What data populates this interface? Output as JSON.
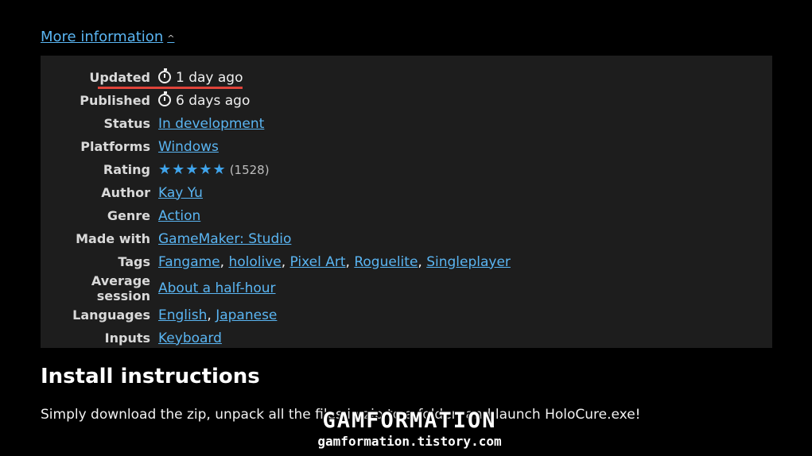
{
  "more_information": {
    "label": "More information"
  },
  "rows": [
    {
      "key": "Updated",
      "value": "1 day ago"
    },
    {
      "key": "Published",
      "value": "6 days ago"
    },
    {
      "key": "Status",
      "value": "In development"
    },
    {
      "key": "Platforms",
      "value": "Windows"
    },
    {
      "key": "Rating",
      "stars": "★★★★★",
      "count": "(1528)"
    },
    {
      "key": "Author",
      "value": "Kay Yu"
    },
    {
      "key": "Genre",
      "value": "Action"
    },
    {
      "key": "Made with",
      "value": "GameMaker: Studio"
    },
    {
      "key": "Tags",
      "values": [
        "Fangame",
        "hololive",
        "Pixel Art",
        "Roguelite",
        "Singleplayer"
      ]
    },
    {
      "key": "Average session",
      "value": "About a half-hour"
    },
    {
      "key": "Languages",
      "values": [
        "English",
        "Japanese"
      ]
    },
    {
      "key": "Inputs",
      "value": "Keyboard"
    }
  ],
  "rating": {
    "stars_filled": 5,
    "stars_max": 5
  },
  "install": {
    "heading": "Install instructions",
    "text": "Simply download the zip, unpack all the files in zip to a folder, and launch HoloCure.exe!"
  },
  "watermark": {
    "title": "GAMFORMATION",
    "url": "gamformation.tistory.com"
  },
  "colors": {
    "link": "#5ab5f2",
    "star": "#3fa3ea",
    "highlight_underline": "#e0443a",
    "panel_bg": "#1d1d1d"
  }
}
